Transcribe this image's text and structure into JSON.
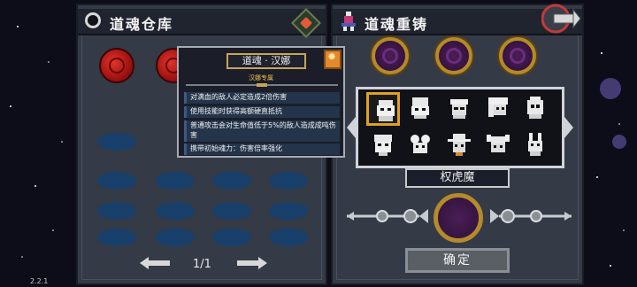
{
  "left_panel": {
    "title": "道魂仓库",
    "pager": {
      "text": "1/1"
    }
  },
  "right_panel": {
    "title": "道魂重铸",
    "selected_name": "权虎魔",
    "confirm_label": "确定"
  },
  "tooltip": {
    "title": "道魂 · 汉娜",
    "subtitle": "汉娜专属",
    "lines": [
      "对满血的敌人必定造成2倍伤害",
      "使用技能时获得高额硬直抵抗",
      "普通攻击会对生命值低于5%的敌人造成成吨伤害",
      "携带初始魂力：伤害倍率强化"
    ]
  },
  "version": "2.2.1",
  "colors": {
    "panel": "#353a47",
    "slot": "#18406b",
    "gold": "#b48a2a",
    "selection": "#e0a21c",
    "tooltip_text_bg": "#24344a"
  },
  "icons": {
    "left_header": "circle-icon",
    "left_action": "gem-icon",
    "right_header": "character-icon",
    "back": "back-arrow-icon"
  }
}
